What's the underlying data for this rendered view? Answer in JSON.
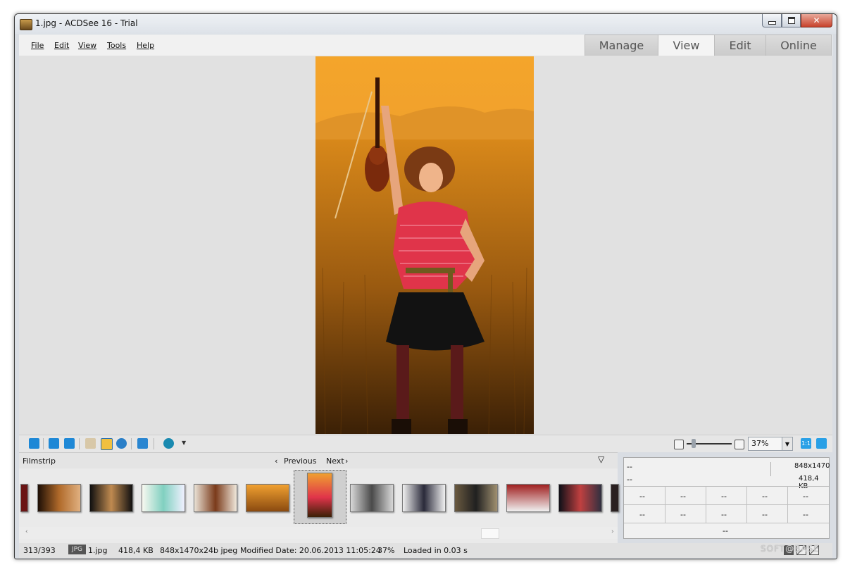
{
  "window": {
    "title": "1.jpg - ACDSee 16 - Trial",
    "close_glyph": "✕"
  },
  "menu": {
    "items": [
      "File",
      "Edit",
      "View",
      "Tools",
      "Help"
    ]
  },
  "modes": {
    "tabs": [
      "Manage",
      "View",
      "Edit",
      "Online"
    ],
    "active": "View"
  },
  "toolbar": {
    "zoom_value": "37%",
    "actual_size_label": "1:1",
    "icons": [
      "auto-lens-icon",
      "rotate-left-icon",
      "rotate-right-icon",
      "hand-tool-icon",
      "select-tool-icon",
      "zoom-tool-icon",
      "full-screen-icon",
      "share-globe-icon",
      "zoom-out-icon",
      "zoom-slider",
      "zoom-in-icon",
      "actual-size-icon",
      "fit-image-icon"
    ]
  },
  "filmstrip": {
    "title": "Filmstrip",
    "previous_label": "Previous",
    "next_label": "Next",
    "thumbnail_count_visible": 13
  },
  "info_panel": {
    "dimensions": "848x1470",
    "file_size": "418,4 KB",
    "placeholder": "--"
  },
  "status": {
    "position": "313/393",
    "format_badge": "JPG",
    "filename": "1.jpg",
    "size": "418,4 KB",
    "dimensions_info": "848x1470x24b jpeg",
    "modified": "Modified Date: 20.06.2013 11:05:24",
    "zoom": "37%",
    "loaded": "Loaded in 0.03 s"
  },
  "watermark": "SOFT@BASE",
  "colors": {
    "accent_blue": "#1e88d6",
    "photo_orange": "#e8951e",
    "shirt_red": "#e0344a"
  }
}
